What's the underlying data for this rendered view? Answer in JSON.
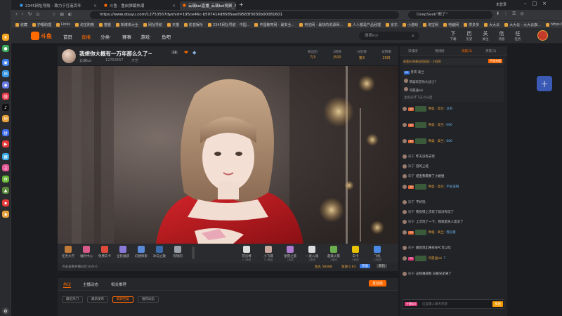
{
  "browser": {
    "tabs": [
      {
        "label": "2345网址导航 - 致力于打造百年"
      },
      {
        "label": "斗鱼 - 重启弹幕热潮"
      },
      {
        "label": "云璃koi直播_云璃koi视频_斗鱼"
      }
    ],
    "user": "未登录",
    "url": "https://www.douyu.com/12753557dyshid=195ce46c-b597414d8585ae09583f3030b00081601",
    "search_text": "DeepSeek\"断了\"",
    "bookmarks": [
      "收藏",
      "护眼助理",
      "Links",
      "淘宝购物",
      "猫猫",
      "新媒体大全",
      "网址导航",
      "天猫",
      "影音娱乐",
      "2345网址导航 - 中国...",
      "中国教育网 - 最安全...",
      "电信网 - 最快的资源网...",
      "人人都是产品经理",
      "京东",
      "小游戏",
      "淘宝网",
      "电脑网",
      "拼多多",
      "大大云",
      "大大云 - 大大云旗...",
      "https://www.ok8888..."
    ]
  },
  "site": {
    "logo_text": "斗鱼",
    "nav": [
      "首页",
      "直播",
      "分类·",
      "赛事",
      "游戏·",
      "鱼吧"
    ],
    "active_nav": "直播",
    "search_placeholder": "搜索koi",
    "header_icons": [
      {
        "icon": "下",
        "label": "下载"
      },
      {
        "icon": "历",
        "label": "历史"
      },
      {
        "icon": "关",
        "label": "关注"
      },
      {
        "icon": "信",
        "label": "消息"
      },
      {
        "icon": "任",
        "label": "任务"
      }
    ]
  },
  "room": {
    "title": "我想你大概有一万年那么久了~",
    "streamer": "云璃koi",
    "room_number": "12753557",
    "category": "才艺",
    "level_badge": "18",
    "stats": [
      {
        "label": "粉丝团",
        "value": "7/3"
      },
      {
        "label": "2周榜",
        "value": "/500"
      },
      {
        "label": "分区榜",
        "value": "第3"
      },
      {
        "label": "试用期",
        "value": "20日"
      }
    ]
  },
  "gifts": {
    "left": [
      {
        "label": "任务大厅",
        "color": "#c07a3a"
      },
      {
        "label": "福利中心",
        "color": "#d95a8a"
      },
      {
        "label": "免费白卡",
        "color": "#e04a3a"
      },
      {
        "label": "全民福袋",
        "color": "#8a7ad8"
      },
      {
        "label": "幻想探索",
        "color": "#5a8ad8"
      },
      {
        "label": "冰与之歌",
        "color": "#3a6aa8"
      },
      {
        "label": "有钱的",
        "color": "#9aa1a8"
      }
    ],
    "right": [
      {
        "label": "荧光棒",
        "sub": "0.1鱼翅",
        "color": "#ddd"
      },
      {
        "label": "小飞碟",
        "sub": "0.1鱼翅",
        "color": "#c9a8a0"
      },
      {
        "label": "星愿之旅",
        "sub": "1鱼翅",
        "color": "#b07ad0"
      },
      {
        "label": "一发入魂",
        "sub": "1鱼翅",
        "color": "#ddd"
      },
      {
        "label": "超级火箭",
        "sub": "2鱼翅",
        "color": "#6ab04c"
      },
      {
        "label": "白卡",
        "sub": "6鱼翅",
        "color": "#e6c200"
      },
      {
        "label": "飞机",
        "sub": "10鱼翅",
        "color": "#4a8ae6"
      }
    ]
  },
  "info_bar": {
    "notice": "点击查看开播日历10点-6",
    "fish_ball": "鱼丸 58468",
    "fish_fin": "鱼翅 0.63",
    "recharge": "充值",
    "backpack": "背包"
  },
  "room_tabs": {
    "tabs": [
      "热议",
      "主播动态",
      "相关推荐"
    ],
    "active": "热议",
    "post_button": "发动态",
    "sub_tabs": [
      "最近热门",
      "最新发布",
      "最新回复",
      "推荐动态"
    ],
    "active_sub": "最新回复"
  },
  "chat": {
    "tabs": [
      "日排榜",
      "周排榜",
      "贡献(1)",
      "贵宾(1)"
    ],
    "active_tab": "贡献(1)",
    "banner": "恭喜koi的粉丝团成员 - 小程序",
    "banner_button": "手游充值",
    "pinned_lines": [
      "贵宾·高兰",
      "恭喜欢迎你大战士?",
      "许愿送koi",
      "主角光环飞天小分型"
    ],
    "messages": [
      {
        "lvl": "19",
        "lvl_color": "#e06a3a",
        "name": "",
        "text": "",
        "name_color": "#ccc",
        "tag": "青蛙 · 高兰:",
        "tag_text": "没有",
        "img": true
      },
      {
        "lvl": "19",
        "lvl_color": "#e06a3a",
        "name": "",
        "text": "",
        "tag": "青蛙 · 高兰:",
        "tag_text": "666",
        "img": true
      },
      {
        "lvl": "19",
        "lvl_color": "#e06a3a",
        "name": "",
        "text": "",
        "tag": "青蛙 · 高兰:",
        "tag_text": "666",
        "img": true
      },
      {
        "lvl": "",
        "name": "知宁",
        "text": "昨天没有去玩"
      },
      {
        "lvl": "",
        "name": "知宁",
        "text": "逛的上班"
      },
      {
        "lvl": "",
        "name": "知宁",
        "text": "结查我需要了小姐姐"
      },
      {
        "lvl": "19",
        "lvl_color": "#e06a3a",
        "name": "",
        "text": "",
        "tag": "青蛙 · 高兰:",
        "tag_text": "不知道啊",
        "img": true
      },
      {
        "lvl": "",
        "name": "知宁",
        "text": "不好玩"
      },
      {
        "lvl": "",
        "name": "知宁",
        "text": "我觉得上次玩了就没有玩了"
      },
      {
        "lvl": "",
        "name": "知宁",
        "text": "上次玩了一下，我就是先人类没了"
      },
      {
        "lvl": "19",
        "lvl_color": "#e06a3a",
        "name": "",
        "text": "",
        "tag": "青蛙 · 高兰:",
        "tag_text": "我没看",
        "img": true
      },
      {
        "lvl": "",
        "name": "知宁",
        "text": "最后现出来有NPC可以吃"
      },
      {
        "lvl": "20",
        "lvl_color": "#d93a7a",
        "name": "",
        "text": "",
        "tag": "许愿送koi",
        "tag_text": "7",
        "img": true
      },
      {
        "lvl": "",
        "name": "知宁",
        "text": "这样难道和 白银兄弟来了"
      }
    ],
    "input_placeholder": "这里输入聊天内容",
    "send": "发送",
    "badge": "夕颜koi"
  },
  "widgets": {
    "bottle": "十"
  },
  "colors": {
    "accent": "#ff6a00",
    "chat_send": "#f59b00"
  }
}
